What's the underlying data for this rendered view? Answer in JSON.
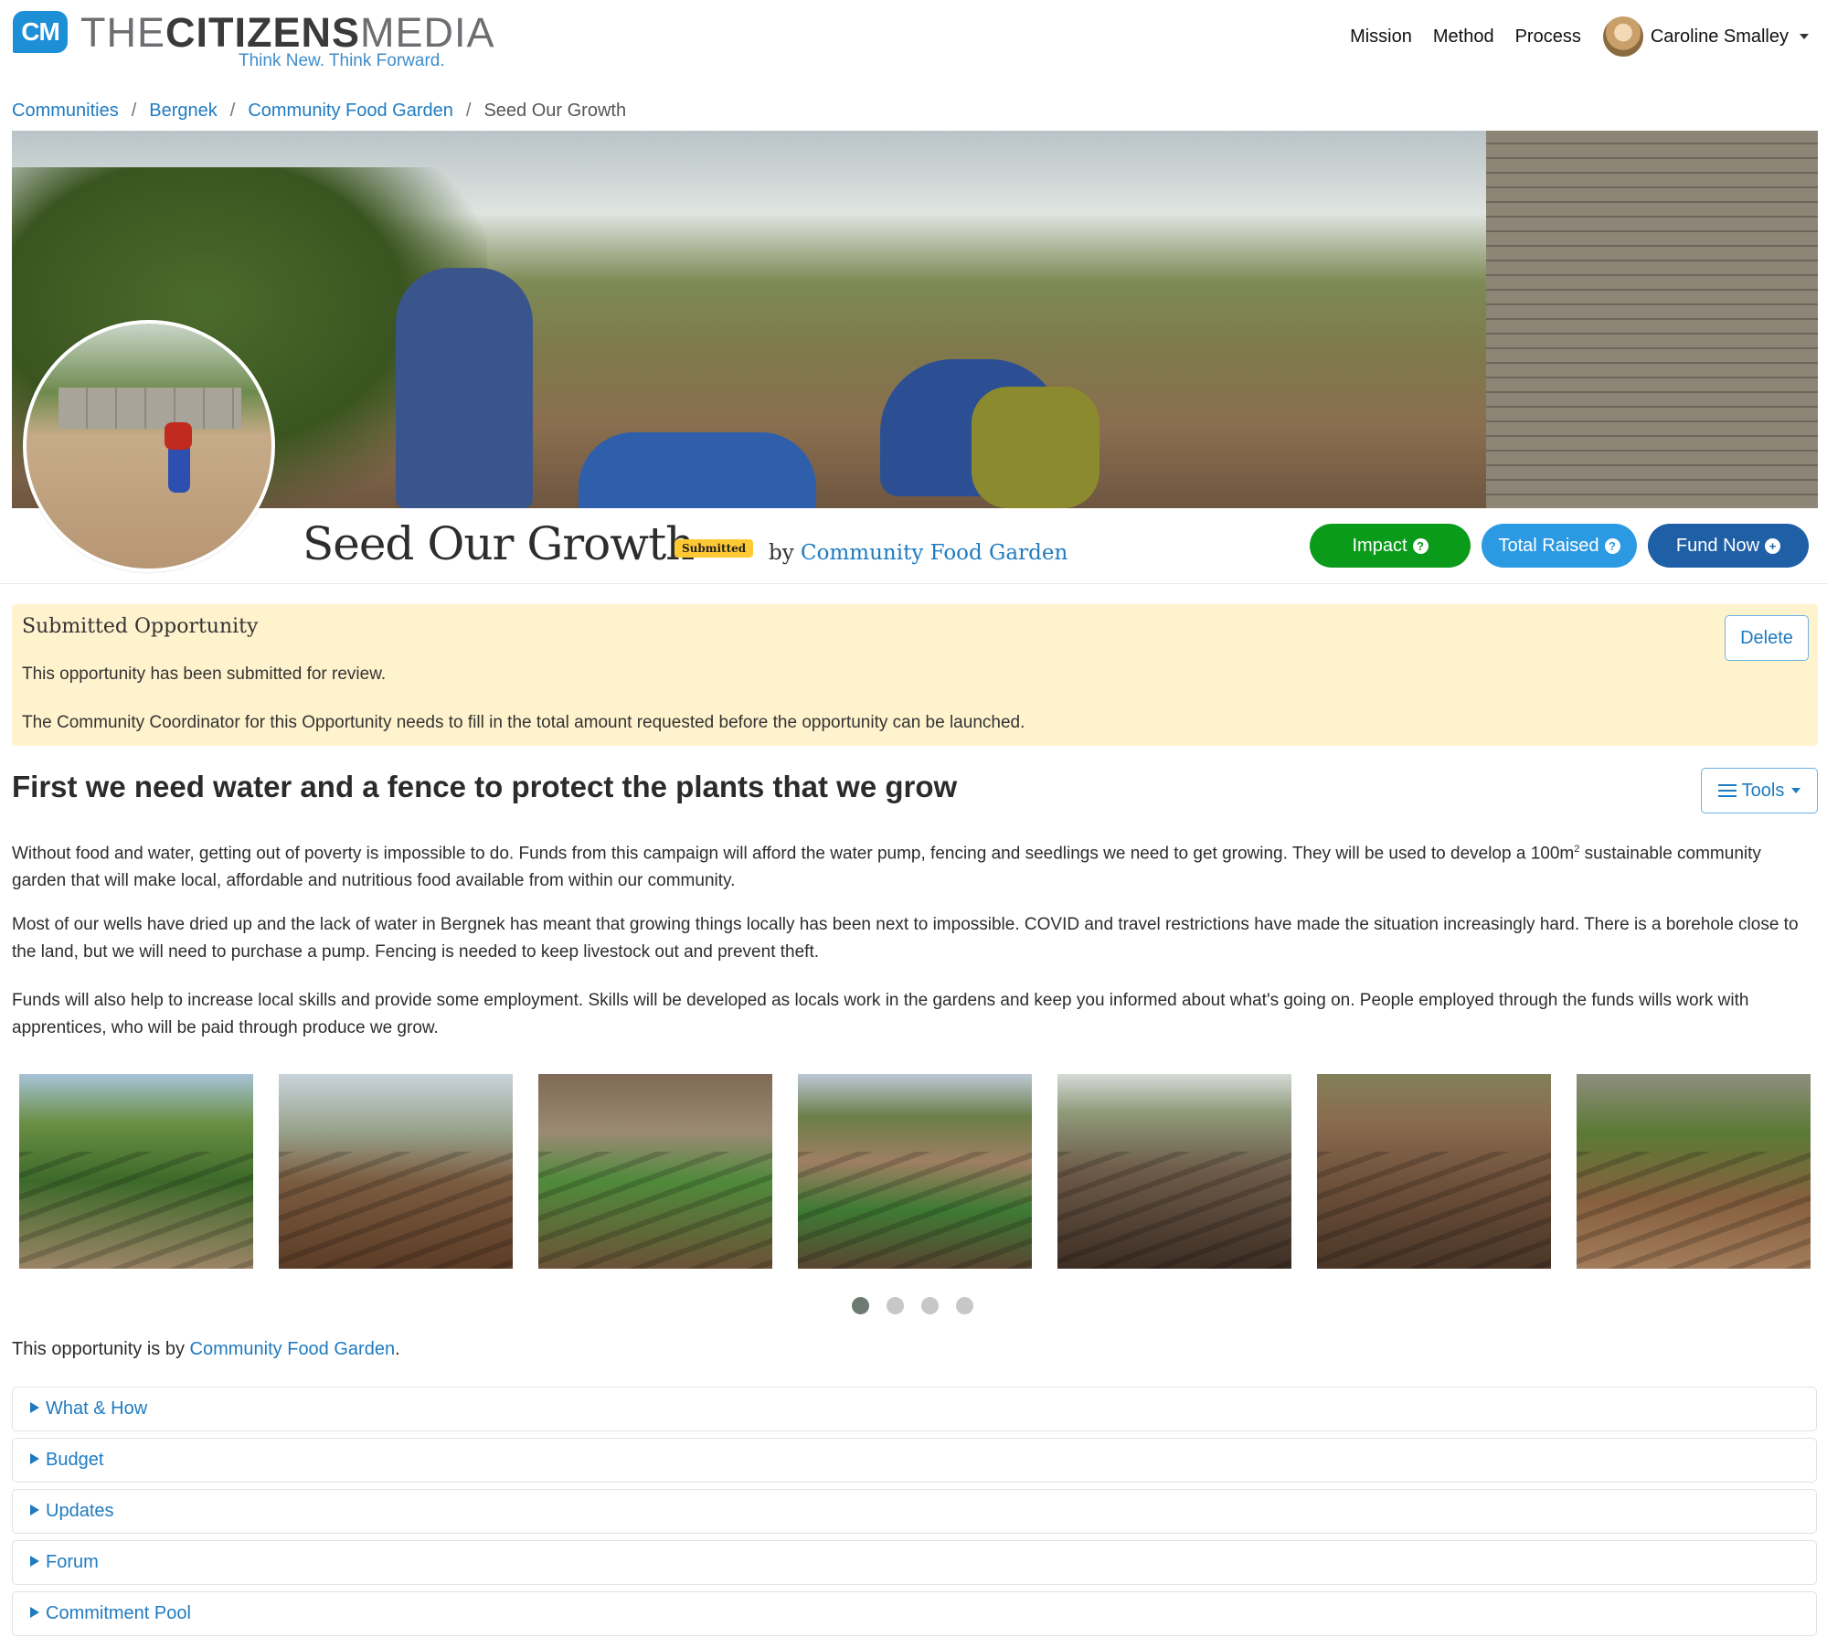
{
  "brand": {
    "badge": "CM",
    "name_part1": "THE",
    "name_part2": "CITIZENS",
    "name_part3": "MEDIA",
    "tagline": "Think New. Think Forward."
  },
  "nav": {
    "items": [
      "Mission",
      "Method",
      "Process"
    ],
    "user_name": "Caroline Smalley"
  },
  "breadcrumb": {
    "items": [
      "Communities",
      "Bergnek",
      "Community Food Garden"
    ],
    "current": "Seed Our Growth"
  },
  "opportunity": {
    "title": "Seed Our Growth",
    "status_badge": "Submitted",
    "by_prefix": "by",
    "by_link": "Community Food Garden"
  },
  "actions": {
    "impact": "Impact",
    "total_raised": "Total Raised",
    "fund_now": "Fund Now"
  },
  "alert": {
    "title": "Submitted Opportunity",
    "line1": "This opportunity has been submitted for review.",
    "line2": "The Community Coordinator for this Opportunity needs to fill in the total amount requested before the opportunity can be launched.",
    "delete_label": "Delete"
  },
  "content": {
    "headline": "First we need water and a fence to protect the plants that we grow",
    "tools_label": "Tools",
    "para1_a": "Without food and water, getting out of poverty is impossible to do. Funds from this campaign will afford the water pump, fencing and seedlings we need to get growing. They will be used to develop a 100m",
    "para1_sup": "2",
    "para1_b": " sustainable community garden that will make local, affordable and nutritious food available from within our community.",
    "para2": "Most of our wells have dried up and the lack of water in Bergnek has meant that growing things locally has been next to impossible. COVID and travel restrictions have made the situation increasingly hard. There is a borehole close to the land, but we will need to purchase a pump. Fencing is needed to keep livestock out and prevent theft.",
    "para3": "Funds will also help to increase local skills and provide some employment. Skills will be developed as locals work in the gardens and keep you informed about what's going on. People employed through the funds wills work with apprentices, who will be paid through produce we grow."
  },
  "gallery": {
    "active_page": 1,
    "page_count": 4
  },
  "footer_by": {
    "prefix": "This opportunity is by ",
    "link": "Community Food Garden",
    "suffix": "."
  },
  "sections": [
    "What & How",
    "Budget",
    "Updates",
    "Forum",
    "Commitment Pool"
  ],
  "colors": {
    "link": "#1f7bc1",
    "impact": "#0b9b1a",
    "total_raised": "#2c9ae3",
    "fund_now": "#1e5fa6",
    "alert_bg": "#fff3cd",
    "badge": "#ffc933"
  }
}
